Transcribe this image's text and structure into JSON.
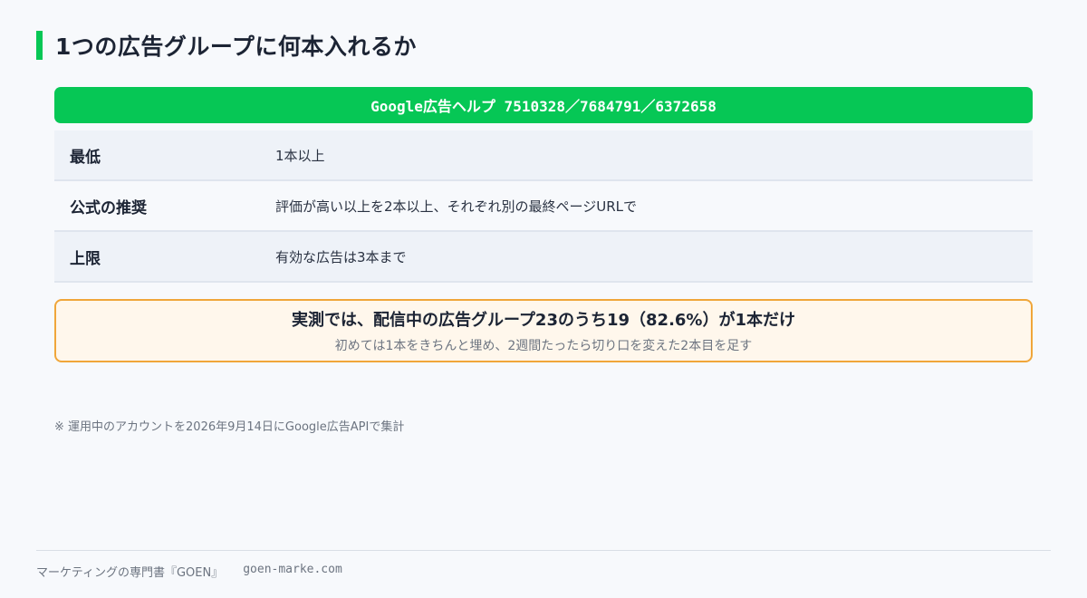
{
  "header": {
    "title": "1つの広告グループに何本入れるか"
  },
  "source_banner": {
    "text": "Google広告ヘルプ 7510328／7684791／6372658"
  },
  "table": {
    "rows": [
      {
        "label": "最低",
        "value": "1本以上"
      },
      {
        "label": "公式の推奨",
        "value": "評価が高い以上を2本以上、それぞれ別の最終ページURLで"
      },
      {
        "label": "上限",
        "value": "有効な広告は3本まで"
      }
    ]
  },
  "callout": {
    "main": "実測では、配信中の広告グループ23のうち19（82.6%）が1本だけ",
    "sub": "初めては1本をきちんと埋め、2週間たったら切り口を変えた2本目を足す"
  },
  "note": {
    "text": "※ 運用中のアカウントを2026年9月14日にGoogle広告APIで集計"
  },
  "footer": {
    "brand": "マーケティングの専門書『GOEN』",
    "url": "goen-marke.com"
  },
  "colors": {
    "accent": "#06c755",
    "callout_border": "#f0a63a",
    "callout_bg": "#fff7ec"
  }
}
